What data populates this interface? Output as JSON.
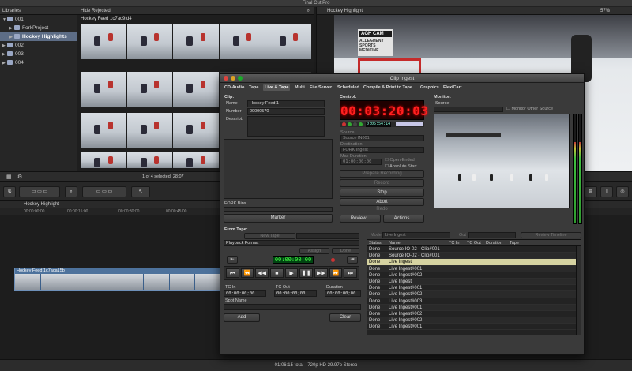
{
  "app": {
    "title": "Final Cut Pro"
  },
  "libraries": {
    "header": "Libraries",
    "items": [
      {
        "label": "001",
        "level": 0,
        "expanded": true
      },
      {
        "label": "ForkProject",
        "level": 1
      },
      {
        "label": "Hockey Highlights",
        "level": 1,
        "selected": true
      },
      {
        "label": "002",
        "level": 0
      },
      {
        "label": "003",
        "level": 0
      },
      {
        "label": "004",
        "level": 0
      }
    ]
  },
  "browser": {
    "filter": "Hide Rejected",
    "clip_name": "Hockey Feed 1c7ac9fd4",
    "selection_info": "1 of 4 selected, 28:07"
  },
  "viewer": {
    "title": "Hockey Highlight",
    "zoom": "57%",
    "ad_header": "AGH CAM",
    "ad_text": "ALLEGHENY SPORTS MEDICINE"
  },
  "timeline": {
    "project": "Hockey Highlight",
    "ruler": [
      "00:00:00:00",
      "00:00:15:00",
      "00:00:30:00",
      "00:00:45:00"
    ],
    "clip_label": "Hockey Feed 1c7aca15b"
  },
  "status_bar": {
    "text": "01:06:15 total - 720p HD 29.97p Stereo"
  },
  "dialog": {
    "title": "Clip Ingest",
    "tabs": [
      "CD-Audio",
      "Tape",
      "Live & Tape",
      "Multi",
      "File Server",
      "Scheduled",
      "Compile & Print to Tape",
      "Graphics",
      "FlexiCart"
    ],
    "active_tab": "Live & Tape",
    "clip": {
      "header": "Clip:",
      "name_label": "Name",
      "name_value": "Hockey Feed 1",
      "number_label": "Number",
      "number_value": "00000570",
      "description_label": "Descript.",
      "bins_label": "FORK Bins",
      "marker_button": "Marker"
    },
    "control": {
      "header": "Control:",
      "timecode": "00:03:20:03",
      "small_timecode": "0:05:54:14",
      "source_label": "Source",
      "source_value": "Source IN001",
      "destination_label": "Destination",
      "destination_value": "FORK Ingest",
      "max_duration_label": "Max Duration",
      "max_duration_value": "01:00:00:00",
      "open_ended": "Open-Ended",
      "absolute_start": "Absolute Start",
      "prepare_button": "Prepare Recording",
      "record_button": "Record",
      "stop_button": "Stop",
      "abort_button": "Abort",
      "redo_button": "Redo",
      "review_button": "Review...",
      "actions_button": "Actions..."
    },
    "monitor": {
      "header": "Monitor:",
      "source_label": "Source",
      "monitor_other_label": "Monitor Other Source"
    },
    "from_tape": {
      "header": "From Tape:",
      "new_tape_button": "New Tape",
      "playback_format": "Playback Format",
      "assign_button": "Assign",
      "done_button": "Done",
      "tc_display": "00:00:00:00",
      "tc_in_label": "TC In",
      "tc_in_value": "00:00:00;00",
      "tc_out_label": "TC Out",
      "tc_out_value": "00:00:00;00",
      "duration_label": "Duration",
      "duration_value": "00:00:00;00",
      "spot_name_label": "Spot Name",
      "add_button": "Add",
      "clear_button": "Clear",
      "transport": [
        "⏮",
        "⏪",
        "◀◀",
        "■",
        "▶",
        "❚❚",
        "▶▶",
        "⏩",
        "⏭"
      ]
    },
    "list": {
      "mode_label": "Mode",
      "mode_value": "Live Ingest",
      "out_label": "Out",
      "review_timeline_button": "Review Timeline",
      "columns": [
        "Status",
        "Name",
        "TC In",
        "TC Out",
        "Duration",
        "Tape"
      ],
      "rows": [
        {
          "status": "Done",
          "name": "Source IO-02 - Clip#001"
        },
        {
          "status": "Done",
          "name": "Source IO-02 - Clip#001"
        },
        {
          "status": "Done",
          "name": "Live Ingest",
          "selected": true
        },
        {
          "status": "Done",
          "name": "Live Ingest#001"
        },
        {
          "status": "Done",
          "name": "Live Ingest#002"
        },
        {
          "status": "Done",
          "name": "Live Ingest"
        },
        {
          "status": "Done",
          "name": "Live Ingest#001"
        },
        {
          "status": "Done",
          "name": "Live Ingest#002"
        },
        {
          "status": "Done",
          "name": "Live Ingest#003"
        },
        {
          "status": "Done",
          "name": "Live Ingest#001"
        },
        {
          "status": "Done",
          "name": "Live Ingest#002"
        },
        {
          "status": "Done",
          "name": "Live Ingest#002"
        },
        {
          "status": "Done",
          "name": "Live Ingest#001"
        }
      ]
    }
  }
}
